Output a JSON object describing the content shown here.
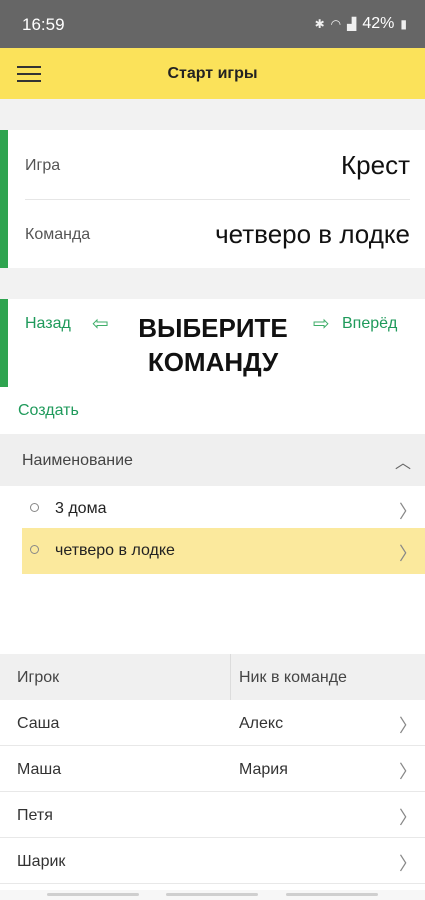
{
  "status_bar": {
    "time": "16:59",
    "battery": "42%",
    "icons": [
      "bluetooth-icon",
      "wifi-icon",
      "signal-icon",
      "battery-icon"
    ]
  },
  "app_bar": {
    "title": "Старт игры",
    "menu_icon": "hamburger-icon",
    "background": "#fbe25a"
  },
  "info": {
    "game_label": "Игра",
    "game_value": "Крест",
    "team_label": "Команда",
    "team_value": "четверо в лодке",
    "accent": "#2ea44f"
  },
  "nav": {
    "back": "Назад",
    "forward": "Вперёд",
    "heading_line1": "ВЫБЕРИТЕ",
    "heading_line2": "КОМАНДУ"
  },
  "actions": {
    "create": "Создать"
  },
  "team_list": {
    "header": "Наименование",
    "items": [
      {
        "label": "3 дома",
        "selected": false
      },
      {
        "label": "четверо в лодке",
        "selected": true
      }
    ],
    "selected_color": "#fbe99d"
  },
  "players_table": {
    "columns": [
      "Игрок",
      "Ник в команде"
    ],
    "rows": [
      [
        "Саша",
        "Алекс"
      ],
      [
        "Маша",
        "Мария"
      ],
      [
        "Петя",
        ""
      ],
      [
        "Шарик",
        ""
      ]
    ]
  }
}
